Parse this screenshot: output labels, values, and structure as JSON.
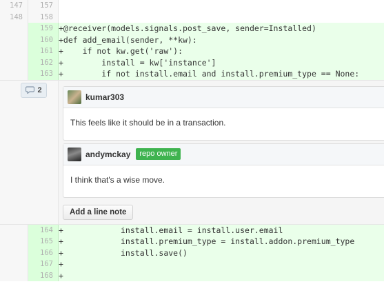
{
  "lines_top": [
    {
      "old": "147",
      "new": "157",
      "code": "",
      "type": "ctx"
    },
    {
      "old": "148",
      "new": "158",
      "code": "",
      "type": "ctx"
    },
    {
      "old": "",
      "new": "159",
      "code": "+@receiver(models.signals.post_save, sender=Installed)",
      "type": "add"
    },
    {
      "old": "",
      "new": "160",
      "code": "+def add_email(sender, **kw):",
      "type": "add"
    },
    {
      "old": "",
      "new": "161",
      "code": "+    if not kw.get('raw'):",
      "type": "add"
    },
    {
      "old": "",
      "new": "162",
      "code": "+        install = kw['instance']",
      "type": "add"
    },
    {
      "old": "",
      "new": "163",
      "code": "+        if not install.email and install.premium_type == None:",
      "type": "add"
    }
  ],
  "comment_thread": {
    "count": "2",
    "comments": [
      {
        "author": "kumar303",
        "badge": "",
        "body": "This feels like it should be in a transaction."
      },
      {
        "author": "andymckay",
        "badge": "repo owner",
        "body": "I think that's a wise move."
      }
    ],
    "add_note_label": "Add a line note"
  },
  "lines_bottom": [
    {
      "old": "",
      "new": "164",
      "code": "+            install.email = install.user.email",
      "type": "add"
    },
    {
      "old": "",
      "new": "165",
      "code": "+            install.premium_type = install.addon.premium_type",
      "type": "add"
    },
    {
      "old": "",
      "new": "166",
      "code": "+            install.save()",
      "type": "add"
    },
    {
      "old": "",
      "new": "167",
      "code": "+",
      "type": "add"
    },
    {
      "old": "",
      "new": "168",
      "code": "+",
      "type": "add"
    }
  ],
  "colors": {
    "added_bg": "#eaffea",
    "badge_green": "#3fb34f"
  },
  "icons": {
    "comment_count": "speech-bubble-icon"
  }
}
